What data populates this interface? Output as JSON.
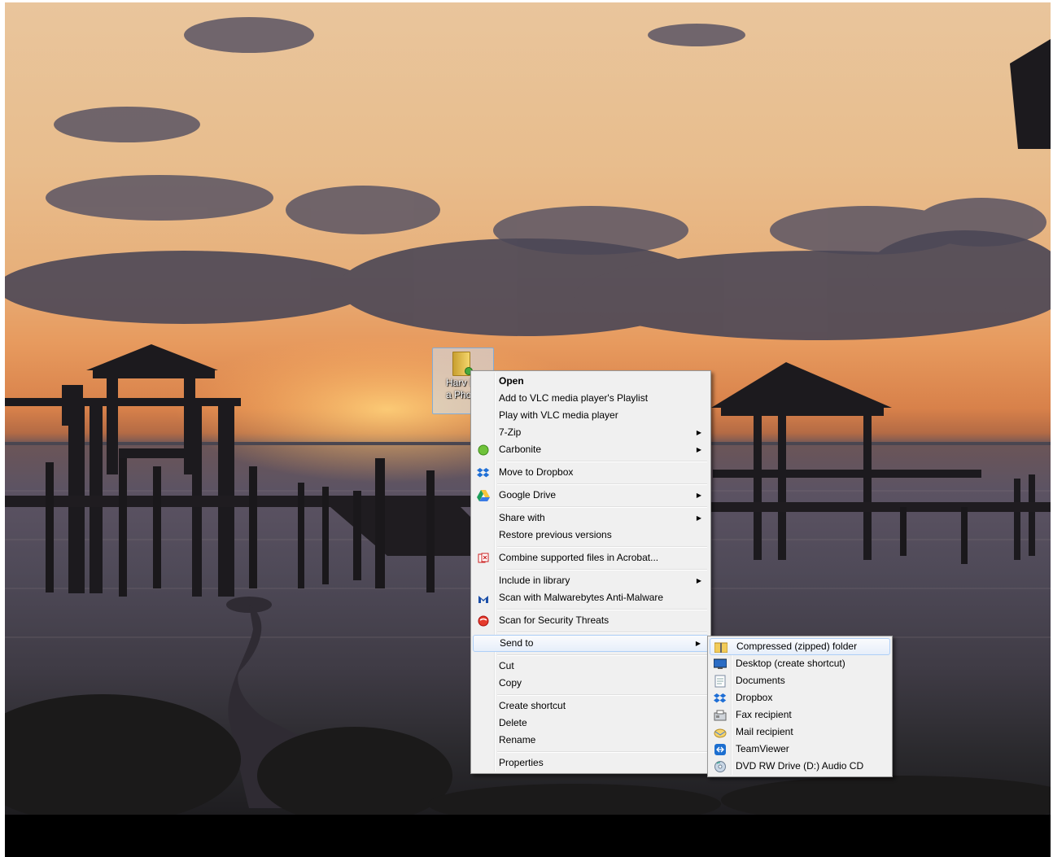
{
  "desktop": {
    "icon_label": "Harv Dama Phot"
  },
  "context_menu": {
    "items": [
      {
        "label": "Open",
        "bold": true
      },
      {
        "label": "Add to VLC media player's Playlist"
      },
      {
        "label": "Play with VLC media player"
      },
      {
        "label": "7-Zip",
        "submenu": true
      },
      {
        "label": "Carbonite",
        "submenu": true,
        "icon": "carbonite-icon"
      },
      {
        "label": "Move to Dropbox",
        "icon": "dropbox-icon"
      },
      {
        "label": "Google Drive",
        "submenu": true,
        "icon": "google-drive-icon"
      },
      {
        "label": "Share with",
        "submenu": true
      },
      {
        "label": "Restore previous versions"
      },
      {
        "label": "Combine supported files in Acrobat...",
        "icon": "acrobat-icon"
      },
      {
        "label": "Include in library",
        "submenu": true
      },
      {
        "label": "Scan with Malwarebytes Anti-Malware",
        "icon": "malwarebytes-icon"
      },
      {
        "label": "Scan for Security Threats",
        "icon": "security-scan-icon"
      },
      {
        "label": "Send to",
        "submenu": true,
        "highlighted": true
      },
      {
        "label": "Cut"
      },
      {
        "label": "Copy"
      },
      {
        "label": "Create shortcut"
      },
      {
        "label": "Delete"
      },
      {
        "label": "Rename"
      },
      {
        "label": "Properties"
      }
    ]
  },
  "send_to_menu": {
    "items": [
      {
        "label": "Compressed (zipped) folder",
        "icon": "zip-folder-icon",
        "highlighted": true
      },
      {
        "label": "Desktop (create shortcut)",
        "icon": "desktop-icon"
      },
      {
        "label": "Documents",
        "icon": "documents-icon"
      },
      {
        "label": "Dropbox",
        "icon": "dropbox-icon"
      },
      {
        "label": "Fax recipient",
        "icon": "fax-icon"
      },
      {
        "label": "Mail recipient",
        "icon": "mail-icon"
      },
      {
        "label": "TeamViewer",
        "icon": "teamviewer-icon"
      },
      {
        "label": "DVD RW Drive (D:) Audio CD",
        "icon": "dvd-drive-icon"
      }
    ]
  },
  "colors": {
    "menu_bg": "#f0f0f0",
    "highlight_border": "#aecff7"
  }
}
